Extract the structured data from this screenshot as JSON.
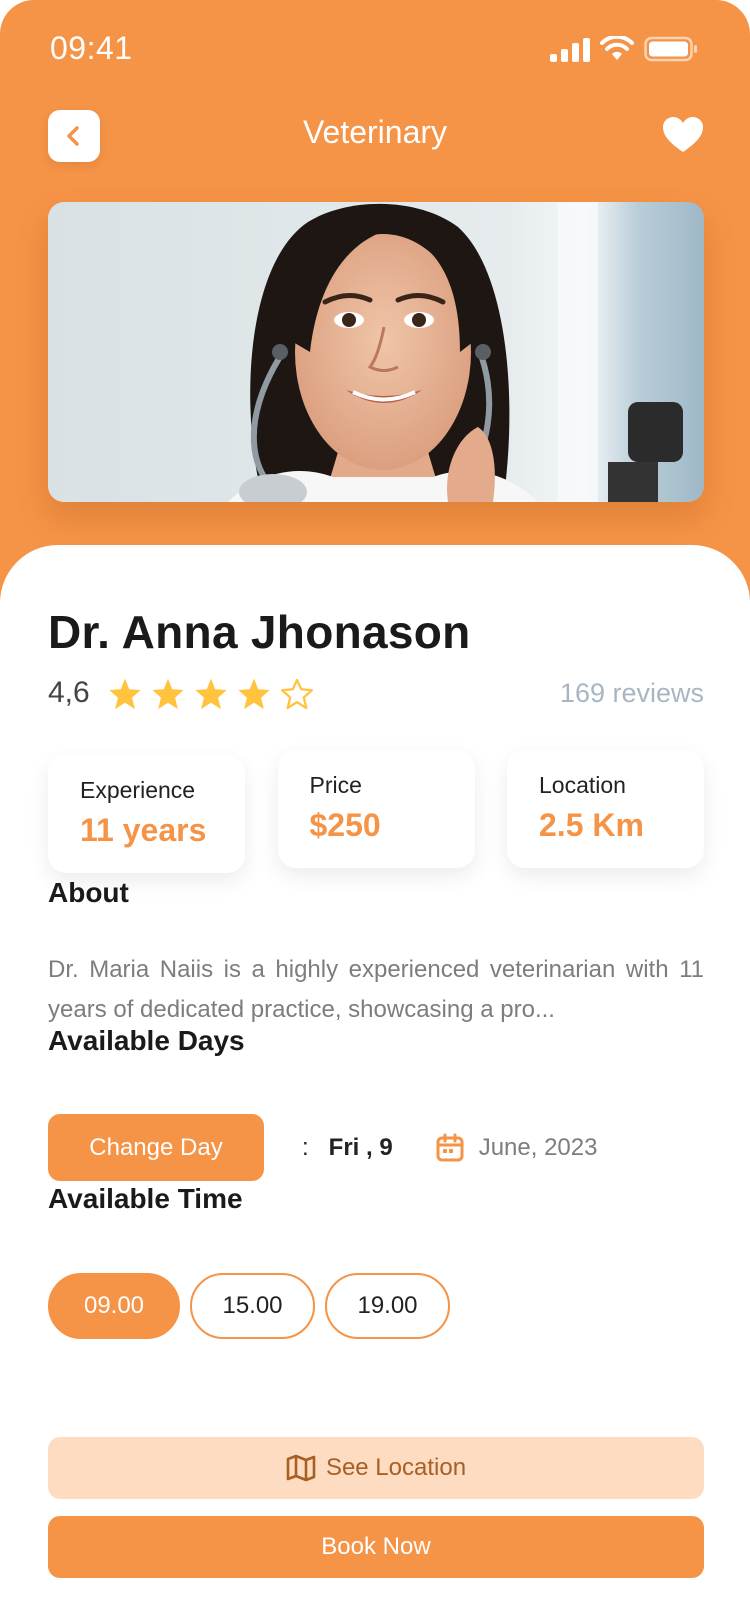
{
  "status_bar": {
    "time": "09:41"
  },
  "nav": {
    "title": "Veterinary",
    "back_icon": "chevron-left-icon",
    "favorite_icon": "heart-icon"
  },
  "doctor": {
    "name": "Dr. Anna Jhonason",
    "rating": "4,6",
    "stars_filled": 4,
    "stars_total": 5,
    "reviews": "169 reviews"
  },
  "stats": [
    {
      "label": "Experience",
      "value": "11 years"
    },
    {
      "label": "Price",
      "value": "$250"
    },
    {
      "label": "Location",
      "value": "2.5 Km"
    }
  ],
  "about": {
    "title": "About",
    "text": "Dr. Maria Naiis is a highly experienced veterinarian with 11 years of dedicated practice, showcasing a pro..."
  },
  "available_days": {
    "title": "Available Days",
    "button": "Change Day",
    "separator": ":",
    "day": "Fri , 9",
    "month": "June, 2023"
  },
  "available_time": {
    "title": "Available Time",
    "slots": [
      "09.00",
      "15.00",
      "19.00"
    ],
    "selected": "09.00"
  },
  "actions": {
    "see_location": "See Location",
    "book_now": "Book Now"
  },
  "colors": {
    "accent": "#F59346",
    "accent_light": "#FDDCC2",
    "star": "#FFC33D"
  }
}
